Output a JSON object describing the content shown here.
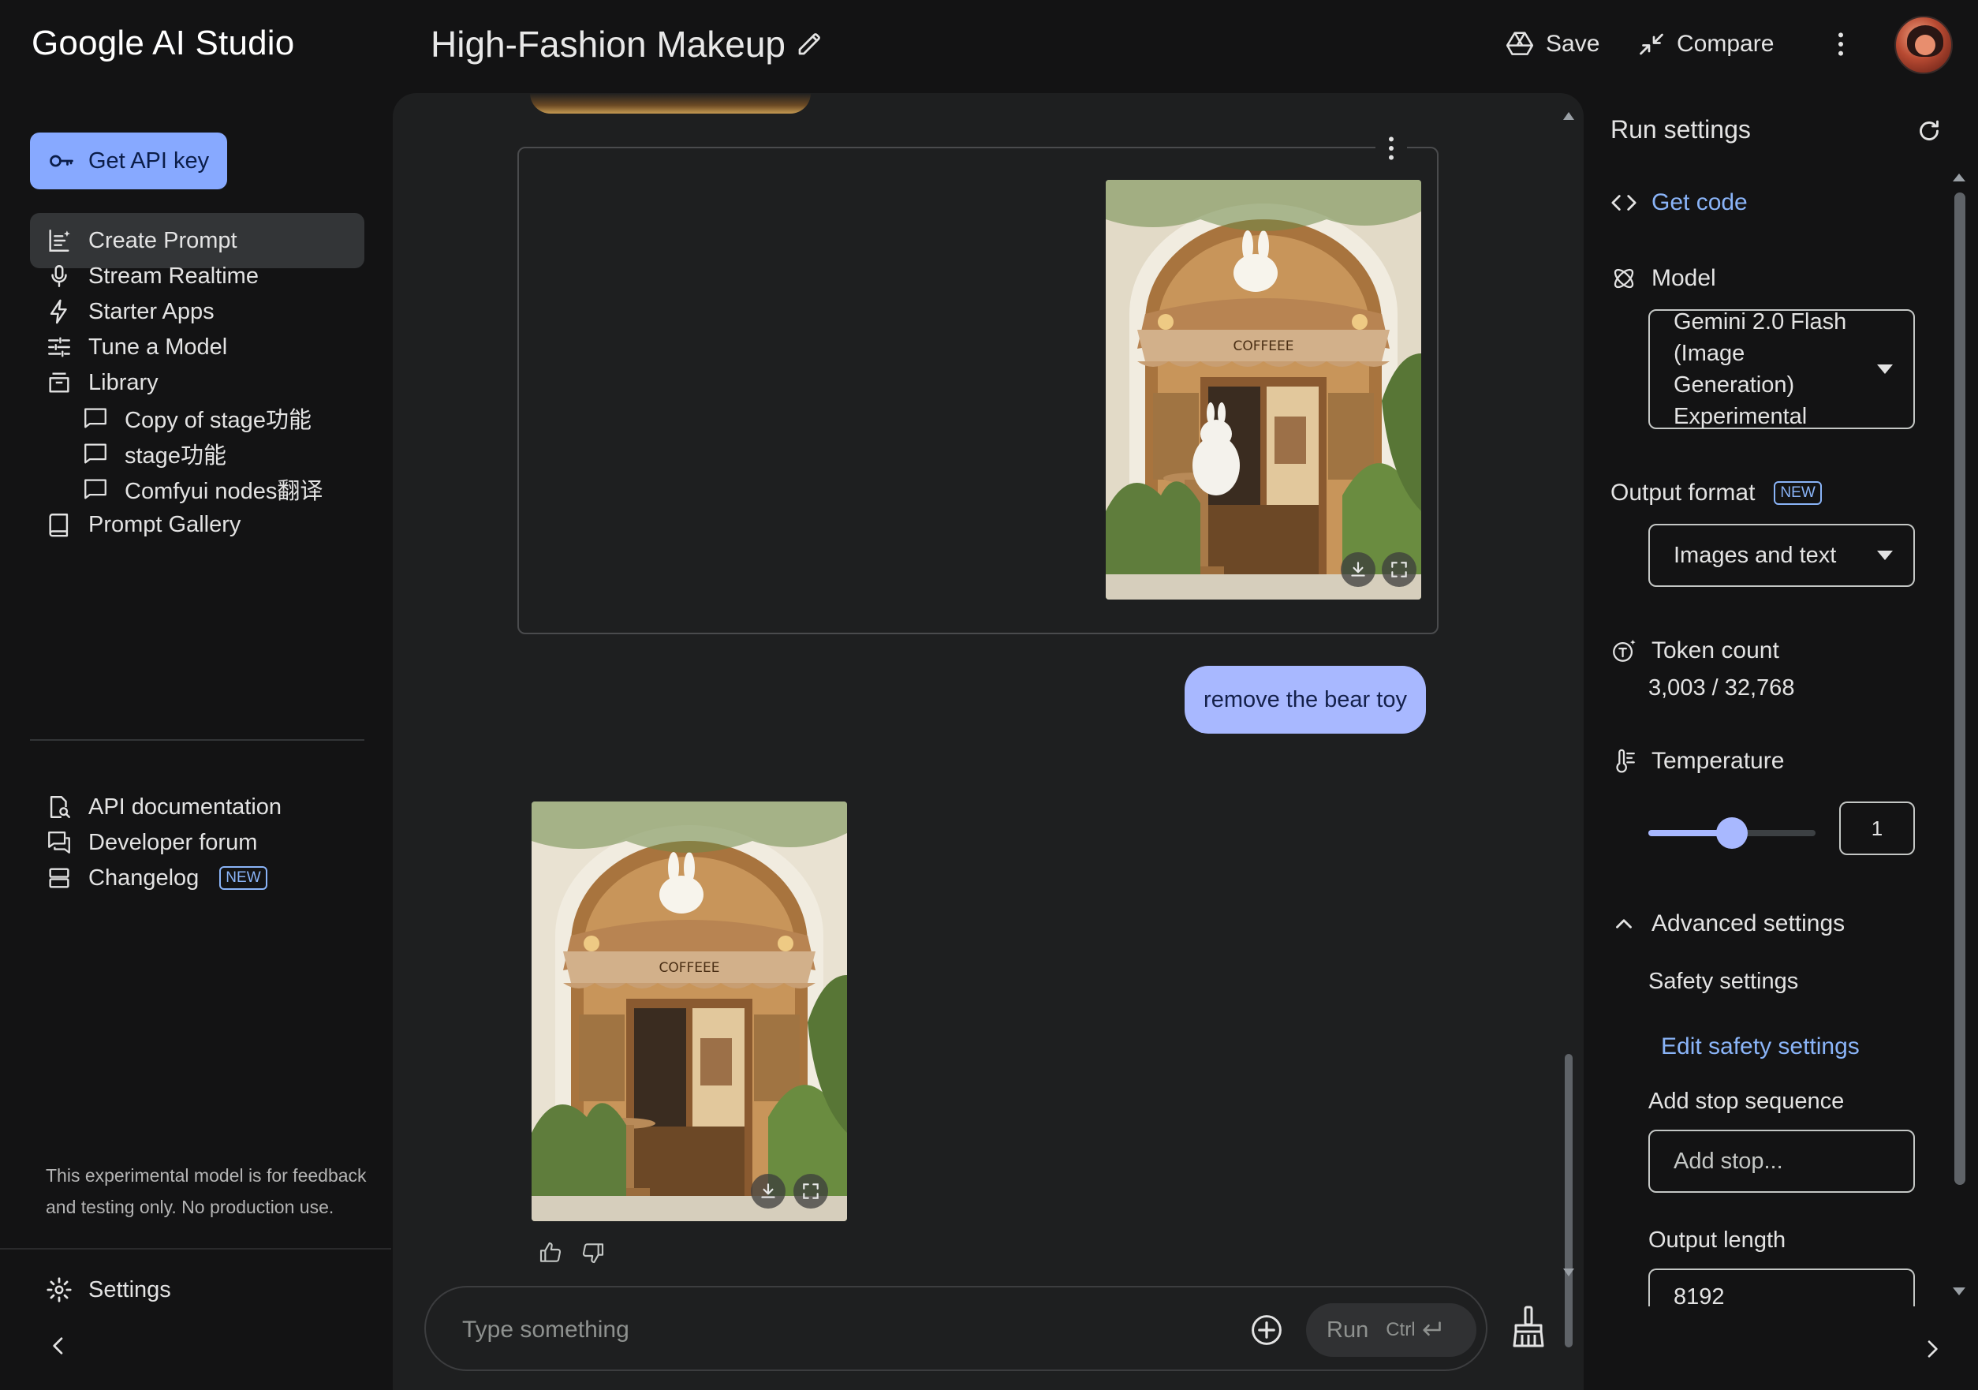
{
  "app": {
    "brand": "Google AI Studio",
    "title": "High-Fashion Makeup"
  },
  "topbar": {
    "save_label": "Save",
    "compare_label": "Compare"
  },
  "sidebar": {
    "api_key_label": "Get API key",
    "items": [
      {
        "label": "Create Prompt",
        "icon": "create-prompt-icon"
      },
      {
        "label": "Stream Realtime",
        "icon": "microphone-icon"
      },
      {
        "label": "Starter Apps",
        "icon": "bolt-icon"
      },
      {
        "label": "Tune a Model",
        "icon": "tune-icon"
      },
      {
        "label": "Library",
        "icon": "library-icon"
      },
      {
        "label": "Copy of stage功能",
        "icon": "chat-bubble-icon"
      },
      {
        "label": "stage功能",
        "icon": "chat-bubble-icon"
      },
      {
        "label": "Comfyui nodes翻译",
        "icon": "chat-bubble-icon"
      },
      {
        "label": "Prompt Gallery",
        "icon": "gallery-icon"
      }
    ],
    "resources": [
      {
        "label": "API documentation",
        "icon": "docs-search-icon"
      },
      {
        "label": "Developer forum",
        "icon": "forum-icon"
      },
      {
        "label": "Changelog",
        "icon": "changelog-icon",
        "badge": "NEW"
      }
    ],
    "disclaimer": "This experimental model is for feedback and testing only. No production use.",
    "settings_label": "Settings"
  },
  "chat": {
    "user_message": "remove the bear toy",
    "image_sign_text": "COFFEEE",
    "input_placeholder": "Type something",
    "run_label": "Run",
    "run_shortcut": "Ctrl"
  },
  "run_settings": {
    "title": "Run settings",
    "get_code_label": "Get code",
    "model_label": "Model",
    "model_value": "Gemini 2.0 Flash (Image Generation) Experimental",
    "output_format_label": "Output format",
    "output_format_badge": "NEW",
    "output_format_value": "Images and text",
    "token_count_label": "Token count",
    "token_count_value": "3,003 / 32,768",
    "temperature_label": "Temperature",
    "temperature_value": "1",
    "temperature_fraction": 0.5,
    "advanced_label": "Advanced settings",
    "safety_label": "Safety settings",
    "edit_safety_label": "Edit safety settings",
    "stop_sequence_label": "Add stop sequence",
    "stop_sequence_placeholder": "Add stop...",
    "output_length_label": "Output length",
    "output_length_value": "8192"
  },
  "colors": {
    "accent": "#87a9ff",
    "link": "#8ab4f8",
    "user_bubble": "#a8b8ff",
    "panel_bg": "#1e1f20",
    "page_bg": "#131314"
  }
}
